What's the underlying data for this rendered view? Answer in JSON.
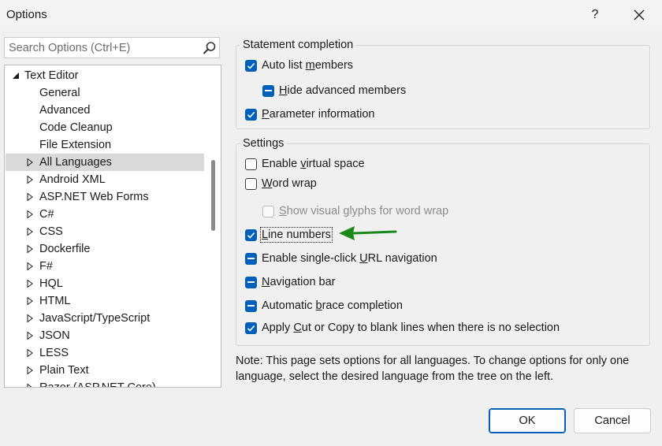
{
  "window": {
    "title": "Options",
    "help_label": "?",
    "close_icon": "close-icon"
  },
  "search": {
    "placeholder": "Search Options (Ctrl+E)",
    "value": "",
    "icon": "search-icon"
  },
  "tree": {
    "items": [
      {
        "label": "Text Editor",
        "expander": "expanded",
        "level": 0,
        "selected": false
      },
      {
        "label": "General",
        "expander": "none",
        "level": 1,
        "selected": false
      },
      {
        "label": "Advanced",
        "expander": "none",
        "level": 1,
        "selected": false
      },
      {
        "label": "Code Cleanup",
        "expander": "none",
        "level": 1,
        "selected": false
      },
      {
        "label": "File Extension",
        "expander": "none",
        "level": 1,
        "selected": false
      },
      {
        "label": "All Languages",
        "expander": "collapsed",
        "level": 1,
        "selected": true
      },
      {
        "label": "Android XML",
        "expander": "collapsed",
        "level": 1,
        "selected": false
      },
      {
        "label": "ASP.NET Web Forms",
        "expander": "collapsed",
        "level": 1,
        "selected": false
      },
      {
        "label": "C#",
        "expander": "collapsed",
        "level": 1,
        "selected": false
      },
      {
        "label": "CSS",
        "expander": "collapsed",
        "level": 1,
        "selected": false
      },
      {
        "label": "Dockerfile",
        "expander": "collapsed",
        "level": 1,
        "selected": false
      },
      {
        "label": "F#",
        "expander": "collapsed",
        "level": 1,
        "selected": false
      },
      {
        "label": "HQL",
        "expander": "collapsed",
        "level": 1,
        "selected": false
      },
      {
        "label": "HTML",
        "expander": "collapsed",
        "level": 1,
        "selected": false
      },
      {
        "label": "JavaScript/TypeScript",
        "expander": "collapsed",
        "level": 1,
        "selected": false
      },
      {
        "label": "JSON",
        "expander": "collapsed",
        "level": 1,
        "selected": false
      },
      {
        "label": "LESS",
        "expander": "collapsed",
        "level": 1,
        "selected": false
      },
      {
        "label": "Plain Text",
        "expander": "collapsed",
        "level": 1,
        "selected": false
      },
      {
        "label": "Razor (ASP.NET Core)",
        "expander": "collapsed",
        "level": 1,
        "selected": false
      }
    ]
  },
  "statement_completion": {
    "title": "Statement completion",
    "options": [
      {
        "pre": "Auto list ",
        "key": "m",
        "post": "embers",
        "state": "checked",
        "enabled": true
      },
      {
        "pre": "",
        "key": "H",
        "post": "ide advanced members",
        "state": "indeterminate",
        "enabled": true
      },
      {
        "pre": "",
        "key": "P",
        "post": "arameter information",
        "state": "checked",
        "enabled": true
      }
    ]
  },
  "settings": {
    "title": "Settings",
    "options": [
      {
        "pre": "Enable ",
        "key": "v",
        "post": "irtual space",
        "state": "unchecked",
        "enabled": true
      },
      {
        "pre": "",
        "key": "W",
        "post": "ord wrap",
        "state": "unchecked",
        "enabled": true
      },
      {
        "pre": "",
        "key": "S",
        "post": "how visual glyphs for word wrap",
        "state": "unchecked",
        "enabled": false
      },
      {
        "pre": "",
        "key": "L",
        "post": "ine numbers",
        "state": "checked",
        "enabled": true,
        "focused": true
      },
      {
        "pre": "Enable single-click ",
        "key": "U",
        "post": "RL navigation",
        "state": "indeterminate",
        "enabled": true
      },
      {
        "pre": "",
        "key": "N",
        "post": "avigation bar",
        "state": "indeterminate",
        "enabled": true
      },
      {
        "pre": "Automatic ",
        "key": "b",
        "post": "race completion",
        "state": "indeterminate",
        "enabled": true
      },
      {
        "pre": "Apply ",
        "key": "C",
        "post": "ut or Copy to blank lines when there is no selection",
        "state": "checked",
        "enabled": true
      }
    ]
  },
  "note": {
    "text": "Note: This page sets options for all languages. To change options for only one language, select the desired language from the tree on the left."
  },
  "buttons": {
    "ok": "OK",
    "cancel": "Cancel"
  },
  "colors": {
    "accent": "#005fb8",
    "arrow": "#1a8a1a",
    "selected_row": "#d9d9d9",
    "background": "#f0f0f0"
  }
}
